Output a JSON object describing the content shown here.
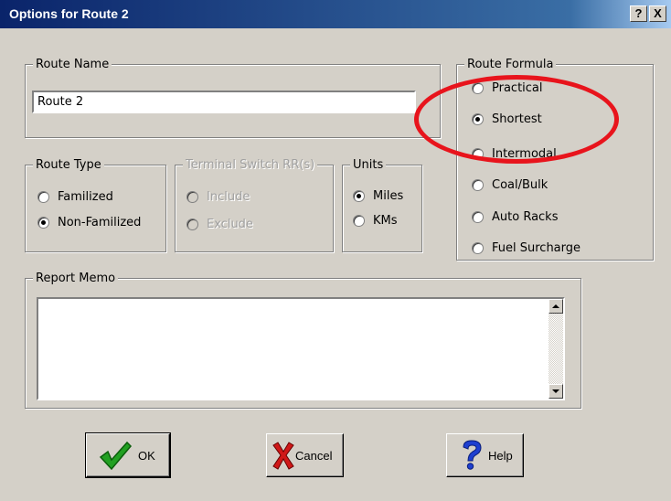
{
  "window": {
    "title": "Options for Route 2",
    "help_glyph": "?",
    "close_glyph": "X"
  },
  "route_name": {
    "legend": "Route Name",
    "value": "Route 2"
  },
  "route_type": {
    "legend": "Route Type",
    "options": [
      {
        "label": "Familized",
        "selected": false
      },
      {
        "label": "Non-Familized",
        "selected": true
      }
    ]
  },
  "terminal_switch": {
    "legend": "Terminal Switch RR(s)",
    "enabled": false,
    "options": [
      {
        "label": "Include",
        "selected": false
      },
      {
        "label": "Exclude",
        "selected": false
      }
    ]
  },
  "units": {
    "legend": "Units",
    "options": [
      {
        "label": "Miles",
        "selected": true
      },
      {
        "label": "KMs",
        "selected": false
      }
    ]
  },
  "route_formula": {
    "legend": "Route Formula",
    "options": [
      {
        "label": "Practical",
        "selected": false
      },
      {
        "label": "Shortest",
        "selected": true
      },
      {
        "label": "Intermodal",
        "selected": false
      },
      {
        "label": "Coal/Bulk",
        "selected": false
      },
      {
        "label": "Auto Racks",
        "selected": false
      },
      {
        "label": "Fuel Surcharge",
        "selected": false
      }
    ]
  },
  "report_memo": {
    "legend": "Report Memo",
    "value": ""
  },
  "buttons": {
    "ok": "OK",
    "cancel": "Cancel",
    "help": "Help"
  },
  "icons": {
    "ok": "green-checkmark-icon",
    "cancel": "red-x-icon",
    "help": "blue-question-icon"
  },
  "colors": {
    "title_bar": "#0a246a",
    "dialog_face": "#d4d0c8",
    "annotation": "#e8141c"
  }
}
